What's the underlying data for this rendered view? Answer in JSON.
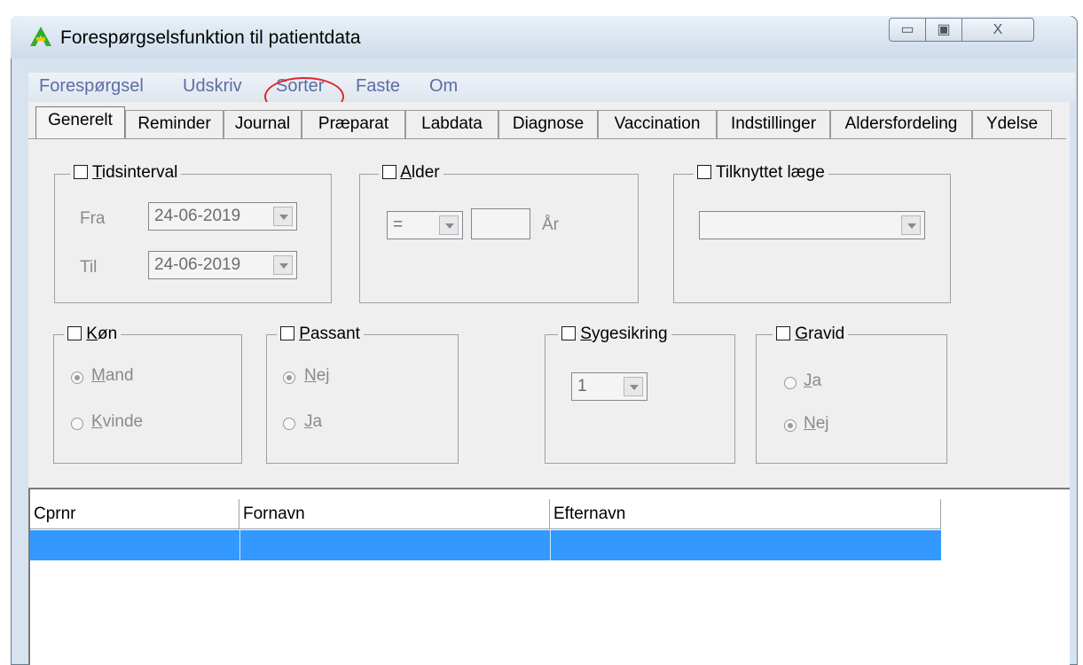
{
  "window": {
    "title": "Forespørgselsfunktion til patientdata",
    "minimize_glyph": "▭",
    "maximize_glyph": "▣",
    "close_glyph": "X",
    "app_icon": "app-logo-icon"
  },
  "menu": {
    "items": [
      "Forespørgsel",
      "Udskriv",
      "Sorter",
      "Faste",
      "Om"
    ]
  },
  "tabs": [
    "Generelt",
    "Reminder",
    "Journal",
    "Præparat",
    "Labdata",
    "Diagnose",
    "Vaccination",
    "Indstillinger",
    "Aldersfordeling",
    "Ydelse"
  ],
  "active_tab": "Generelt",
  "tidsinterval": {
    "label_first": "T",
    "label_rest": "idsinterval",
    "checked": false,
    "fra_label": "Fra",
    "fra_value": "24-06-2019",
    "til_label": "Til",
    "til_value": "24-06-2019"
  },
  "alder": {
    "label_first": "A",
    "label_rest": "lder",
    "checked": false,
    "operator": "=",
    "value": "",
    "unit": "År"
  },
  "tilknyttet": {
    "label": "Tilknyttet læge",
    "checked": false,
    "value": ""
  },
  "koen": {
    "label_first": "K",
    "label_rest": "øn",
    "checked": false,
    "opt1_first": "M",
    "opt1_rest": "and",
    "opt1_selected": true,
    "opt2_first": "K",
    "opt2_rest": "vinde",
    "opt2_selected": false
  },
  "passant": {
    "label_first": "P",
    "label_rest": "assant",
    "checked": false,
    "opt1_first": "N",
    "opt1_rest": "ej",
    "opt1_selected": true,
    "opt2_first": "J",
    "opt2_rest": "a",
    "opt2_selected": false
  },
  "sygesikring": {
    "label_first": "S",
    "label_rest": "ygesikring",
    "checked": false,
    "value": "1"
  },
  "gravid": {
    "label_first": "G",
    "label_rest": "ravid",
    "checked": false,
    "opt1_first": "J",
    "opt1_rest": "a",
    "opt1_selected": false,
    "opt2_first": "N",
    "opt2_rest": "ej",
    "opt2_selected": true
  },
  "grid": {
    "columns": [
      "Cprnr",
      "Fornavn",
      "Efternavn"
    ],
    "selected_row_color": "#3399ff"
  },
  "annotation_color": "#e0262c"
}
